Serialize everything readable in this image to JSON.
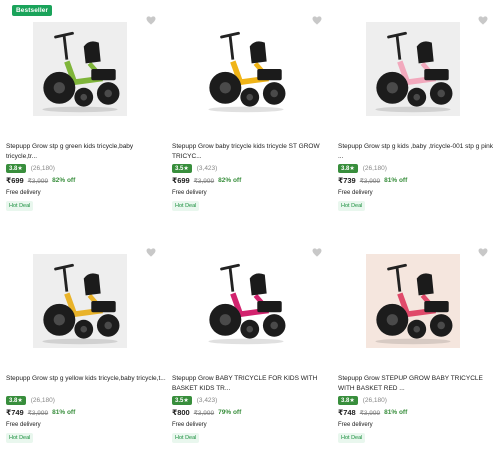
{
  "products": [
    {
      "badge": "Bestseller",
      "title": "Stepupp Grow stp g green kids tricycle,baby tricycle,tr...",
      "rating": "3.8★",
      "count": "(26,180)",
      "price": "₹699",
      "mrp": "₹3,999",
      "off": "82% off",
      "delivery": "Free delivery",
      "deal": "Hot Deal",
      "frame_color": "#7fb53a",
      "bg": "#eeeeee"
    },
    {
      "badge": "",
      "title": "Stepupp Grow baby tricycle kids tricycle ST GROW TRICYC...",
      "rating": "3.5★",
      "count": "(3,423)",
      "price": "₹699",
      "mrp": "₹3,999",
      "off": "82% off",
      "delivery": "Free delivery",
      "deal": "Hot Deal",
      "frame_color": "#f0b417",
      "bg": "#ffffff"
    },
    {
      "badge": "",
      "title": "Stepupp Grow stp g kids ,baby ,tricycle-001 stp g pink ...",
      "rating": "3.8★",
      "count": "(26,180)",
      "price": "₹739",
      "mrp": "₹3,999",
      "off": "81% off",
      "delivery": "Free delivery",
      "deal": "Hot Deal",
      "frame_color": "#f2a9bd",
      "bg": "#eeeeee"
    },
    {
      "badge": "",
      "title": "Stepupp Grow stp g yellow kids tricycle,baby tricycle,t...",
      "rating": "3.8★",
      "count": "(26,180)",
      "price": "₹749",
      "mrp": "₹3,999",
      "off": "81% off",
      "delivery": "Free delivery",
      "deal": "Hot Deal",
      "frame_color": "#e9b32a",
      "bg": "#eeeeee"
    },
    {
      "badge": "",
      "title": "Stepupp Grow BABY TRICYCLE FOR KIDS WITH BASKET KIDS TR...",
      "rating": "3.5★",
      "count": "(3,423)",
      "price": "₹800",
      "mrp": "₹3,999",
      "off": "79% off",
      "delivery": "Free delivery",
      "deal": "Hot Deal",
      "frame_color": "#d2236e",
      "bg": "#ffffff"
    },
    {
      "badge": "",
      "title": "Stepupp Grow STEPUP GROW BABY TRICYCLE WITH BASKET RED ...",
      "rating": "3.8★",
      "count": "(26,180)",
      "price": "₹748",
      "mrp": "₹3,999",
      "off": "81% off",
      "delivery": "Free delivery",
      "deal": "Hot Deal",
      "frame_color": "#e04a6a",
      "bg": "#f5e6de"
    }
  ]
}
